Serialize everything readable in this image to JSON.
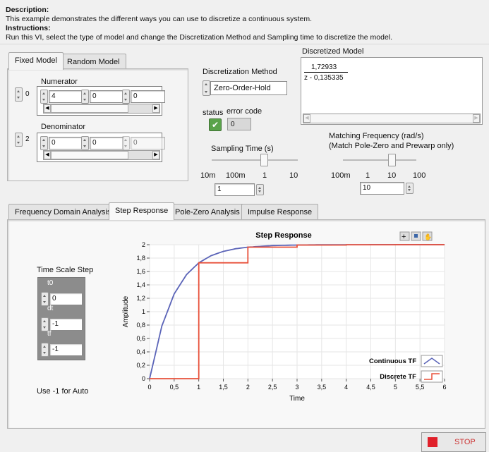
{
  "description": {
    "label": "Description",
    "text": "This example demonstrates the different ways you can use to discretize a continuous system.",
    "instructions_label": "Instructions",
    "instructions_text": "Run this VI, select the type of model and change the Discretization Method and Sampling time to discretize the model."
  },
  "model_tabs": [
    {
      "label": "Fixed Model"
    },
    {
      "label": "Random Model"
    }
  ],
  "numerator": {
    "label": "Numerator",
    "index": "0",
    "values": [
      "4",
      "0",
      "0"
    ]
  },
  "denominator": {
    "label": "Denominator",
    "index": "2",
    "values": [
      "0",
      "0",
      "0"
    ]
  },
  "discretization": {
    "label": "Discretization Method",
    "value": "Zero-Order-Hold"
  },
  "status": {
    "label": "status",
    "error_label": "error code",
    "error_value": "0"
  },
  "discretized_model": {
    "label": "Discretized Model",
    "numerator": "1,72933",
    "denominator": "z - 0,135335"
  },
  "sampling_time": {
    "label": "Sampling Time (s)",
    "ticks": [
      "10m",
      "100m",
      "1",
      "10"
    ],
    "value": "1"
  },
  "matching_frequency": {
    "label_line1": "Matching Frequency (rad/s)",
    "label_line2": "(Match Pole-Zero and Prewarp only)",
    "ticks": [
      "100m",
      "1",
      "10",
      "100"
    ],
    "value": "10"
  },
  "analysis_tabs": [
    {
      "label": "Frequency Domain Analysis"
    },
    {
      "label": "Step Response"
    },
    {
      "label": "Pole-Zero Analysis"
    },
    {
      "label": "Impulse Response"
    }
  ],
  "time_scale": {
    "label": "Time Scale Step",
    "t0_label": "t0",
    "t0": "0",
    "dt_label": "dt",
    "dt": "-1",
    "tf_label": "tf",
    "tf": "-1",
    "note": "Use -1 for Auto"
  },
  "stop_label": "STOP",
  "colors": {
    "continuous": "#5b64b8",
    "discrete": "#e8503a"
  },
  "chart_data": {
    "type": "line",
    "title": "Step Response",
    "xlabel": "Time",
    "ylabel": "Amplitude",
    "xlim": [
      0,
      6
    ],
    "ylim": [
      0,
      2
    ],
    "xticks": [
      "0",
      "0,5",
      "1",
      "1,5",
      "2",
      "2,5",
      "3",
      "3,5",
      "4",
      "4,5",
      "5",
      "5,5",
      "6"
    ],
    "yticks": [
      "0",
      "0,2",
      "0,4",
      "0,6",
      "0,8",
      "1",
      "1,2",
      "1,4",
      "1,6",
      "1,8",
      "2"
    ],
    "legend_position": "bottom-right",
    "series": [
      {
        "name": "Continuous TF",
        "x": [
          0,
          0.25,
          0.5,
          0.75,
          1,
          1.25,
          1.5,
          1.75,
          2,
          2.5,
          3,
          3.5,
          4,
          5,
          6
        ],
        "y": [
          0,
          0.787,
          1.264,
          1.553,
          1.729,
          1.836,
          1.9,
          1.94,
          1.963,
          1.987,
          1.995,
          1.998,
          1.999,
          2.0,
          2.0
        ]
      },
      {
        "name": "Discrete TF",
        "x": [
          0,
          1,
          1,
          2,
          2,
          3,
          3,
          4,
          4,
          5,
          5,
          6
        ],
        "y": [
          0,
          0,
          1.729,
          1.729,
          1.963,
          1.963,
          1.995,
          1.995,
          1.999,
          1.999,
          2.0,
          2.0
        ]
      }
    ]
  }
}
